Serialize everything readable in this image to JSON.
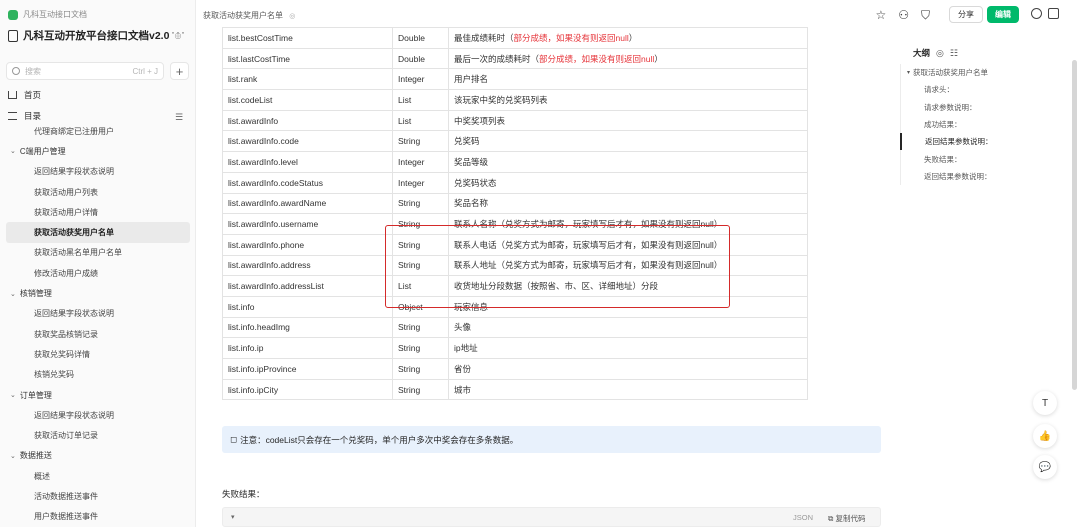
{
  "sidebar": {
    "breadcrumb": "凡科互动接口文档",
    "doc_title": "凡科互动开放平台接口文档v2.0",
    "title_mark": "◎",
    "more": "···",
    "search_placeholder": "搜索",
    "search_shortcut": "Ctrl + J",
    "add": "+",
    "home": "首页",
    "toc": "目录",
    "toc_filter": "☰",
    "tree": [
      {
        "label": "代理商绑定已注册用户",
        "type": "leaf"
      },
      {
        "label": "C端用户管理",
        "type": "group"
      },
      {
        "label": "返回结果字段状态说明",
        "type": "leaf"
      },
      {
        "label": "获取活动用户列表",
        "type": "leaf"
      },
      {
        "label": "获取活动用户详情",
        "type": "leaf"
      },
      {
        "label": "获取活动获奖用户名单",
        "type": "active"
      },
      {
        "label": "获取活动黑名单用户名单",
        "type": "leaf"
      },
      {
        "label": "修改活动用户成绩",
        "type": "leaf"
      },
      {
        "label": "核销管理",
        "type": "group"
      },
      {
        "label": "返回结果字段状态说明",
        "type": "leaf"
      },
      {
        "label": "获取奖品核销记录",
        "type": "leaf"
      },
      {
        "label": "获取兑奖码详情",
        "type": "leaf"
      },
      {
        "label": "核销兑奖码",
        "type": "leaf"
      },
      {
        "label": "订单管理",
        "type": "group"
      },
      {
        "label": "返回结果字段状态说明",
        "type": "leaf"
      },
      {
        "label": "获取活动订单记录",
        "type": "leaf"
      },
      {
        "label": "数据推送",
        "type": "group"
      },
      {
        "label": "概述",
        "type": "leaf"
      },
      {
        "label": "活动数据推送事件",
        "type": "leaf"
      },
      {
        "label": "用户数据推送事件",
        "type": "leaf"
      }
    ]
  },
  "header": {
    "tab_title": "获取活动获奖用户名单",
    "tab_mark": "◎",
    "star_icon": "☆",
    "user_icon": "⚇",
    "present_icon": "⛉",
    "share_label": "分享",
    "edit_label": "编辑"
  },
  "table": {
    "rows": [
      {
        "field": "list.bestCostTime",
        "type": "Double",
        "desc": "最佳成绩耗时（",
        "note": "部分成绩，如果没有则返回null",
        "tail": "）"
      },
      {
        "field": "list.lastCostTime",
        "type": "Double",
        "desc": "最后一次的成绩耗时（",
        "note": "部分成绩，如果没有则返回null",
        "tail": "）"
      },
      {
        "field": "list.rank",
        "type": "Integer",
        "desc": "用户排名",
        "note": "",
        "tail": ""
      },
      {
        "field": "list.codeList",
        "type": "List",
        "desc": "该玩家中奖的兑奖码列表",
        "note": "",
        "tail": ""
      },
      {
        "field": "list.awardInfo",
        "type": "List",
        "desc": "中奖奖项列表",
        "note": "",
        "tail": ""
      },
      {
        "field": "list.awardInfo.code",
        "type": "String",
        "desc": "兑奖码",
        "note": "",
        "tail": ""
      },
      {
        "field": "list.awardInfo.level",
        "type": "Integer",
        "desc": "奖品等级",
        "note": "",
        "tail": ""
      },
      {
        "field": "list.awardInfo.codeStatus",
        "type": "Integer",
        "desc": "兑奖码状态",
        "note": "",
        "tail": ""
      },
      {
        "field": "list.awardInfo.awardName",
        "type": "String",
        "desc": "奖品名称",
        "note": "",
        "tail": ""
      },
      {
        "field": "list.awardInfo.username",
        "type": "String",
        "desc": "联系人名称（兑奖方式为邮寄，玩家填写后才有，如果没有则返回null）",
        "note": "",
        "tail": ""
      },
      {
        "field": "list.awardInfo.phone",
        "type": "String",
        "desc": "联系人电话（兑奖方式为邮寄，玩家填写后才有，如果没有则返回null）",
        "note": "",
        "tail": ""
      },
      {
        "field": "list.awardInfo.address",
        "type": "String",
        "desc": "联系人地址（兑奖方式为邮寄，玩家填写后才有，如果没有则返回null）",
        "note": "",
        "tail": ""
      },
      {
        "field": "list.awardInfo.addressList",
        "type": "List",
        "desc": "收货地址分段数据（按照省、市、区、详细地址）分段",
        "note": "",
        "tail": ""
      },
      {
        "field": "list.info",
        "type": "Object",
        "desc": "玩家信息",
        "note": "",
        "tail": ""
      },
      {
        "field": "list.info.headImg",
        "type": "String",
        "desc": "头像",
        "note": "",
        "tail": ""
      },
      {
        "field": "list.info.ip",
        "type": "String",
        "desc": "ip地址",
        "note": "",
        "tail": ""
      },
      {
        "field": "list.info.ipProvince",
        "type": "String",
        "desc": "省份",
        "note": "",
        "tail": ""
      },
      {
        "field": "list.info.ipCity",
        "type": "String",
        "desc": "城市",
        "note": "",
        "tail": ""
      }
    ]
  },
  "note": {
    "icon": "◻",
    "text": "注意：codeList只会存在一个兑奖码，单个用户多次中奖会存在多条数据。"
  },
  "fail_label": "失败结果：",
  "code": {
    "caret": "▾",
    "lang": "JSON",
    "copy_label": "⧉ 复制代码"
  },
  "outline": {
    "title": "大纲",
    "eye_icon": "◎",
    "list_icon": "☷",
    "items": [
      {
        "label": "获取活动获奖用户名单",
        "level": "top"
      },
      {
        "label": "请求头：",
        "level": "sub"
      },
      {
        "label": "请求参数说明：",
        "level": "sub"
      },
      {
        "label": "成功结果：",
        "level": "sub"
      },
      {
        "label": "返回结果参数说明：",
        "level": "current"
      },
      {
        "label": "失败结果：",
        "level": "sub"
      },
      {
        "label": "返回结果参数说明：",
        "level": "sub"
      }
    ]
  },
  "float_tools": {
    "top_icon": "T",
    "like_icon": "👍",
    "comment_icon": "💬"
  },
  "colors": {
    "accent": "#00b96b",
    "highlight_border": "#d42a2a",
    "note_bg": "#e8f1fc",
    "red_text": "#e6343a"
  }
}
